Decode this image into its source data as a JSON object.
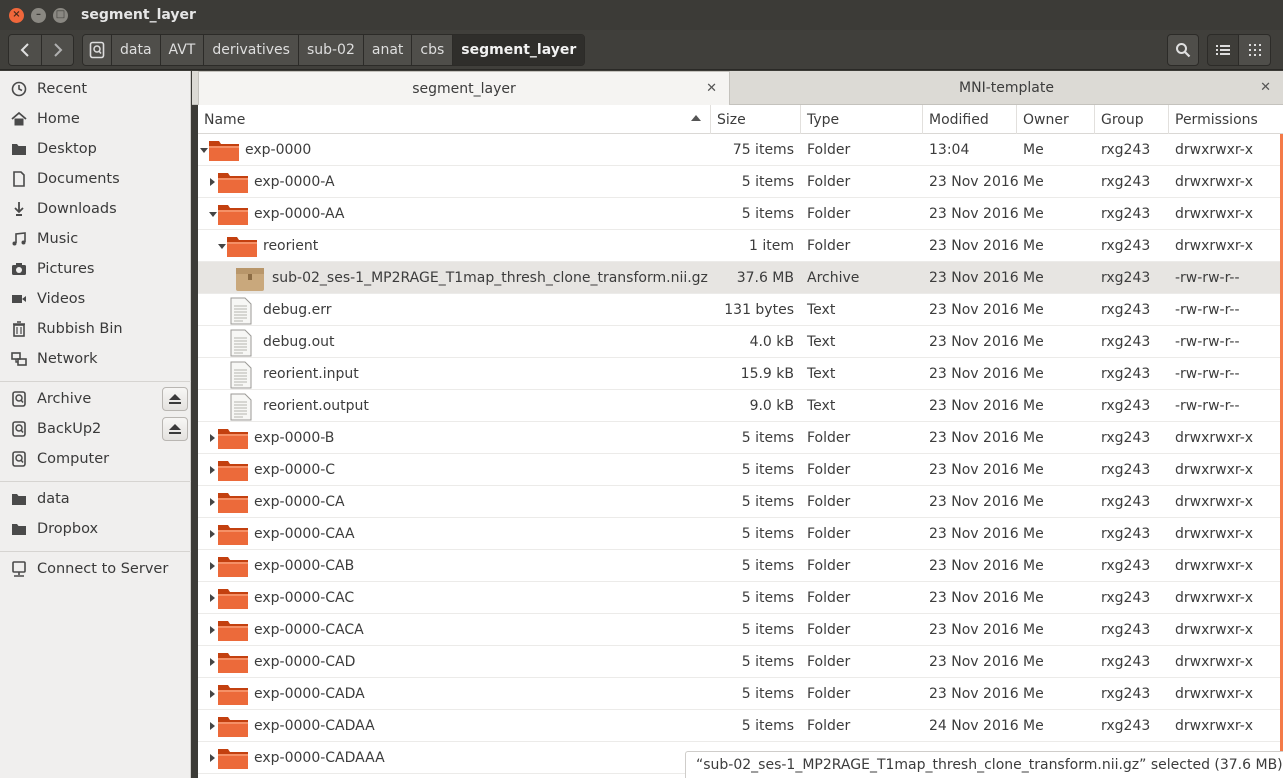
{
  "window": {
    "title": "segment_layer"
  },
  "breadcrumbs": [
    "data",
    "AVT",
    "derivatives",
    "sub-02",
    "anat",
    "cbs",
    "segment_layer"
  ],
  "sidebar": {
    "places": [
      {
        "label": "Recent",
        "icon": "clock-icon"
      },
      {
        "label": "Home",
        "icon": "home-icon"
      },
      {
        "label": "Desktop",
        "icon": "folder-icon"
      },
      {
        "label": "Documents",
        "icon": "document-icon"
      },
      {
        "label": "Downloads",
        "icon": "download-icon"
      },
      {
        "label": "Music",
        "icon": "music-icon"
      },
      {
        "label": "Pictures",
        "icon": "camera-icon"
      },
      {
        "label": "Videos",
        "icon": "video-icon"
      },
      {
        "label": "Rubbish Bin",
        "icon": "trash-icon"
      },
      {
        "label": "Network",
        "icon": "network-icon"
      }
    ],
    "devices": [
      {
        "label": "Archive",
        "icon": "drive-icon",
        "eject": true
      },
      {
        "label": "BackUp2",
        "icon": "drive-icon",
        "eject": true
      },
      {
        "label": "Computer",
        "icon": "drive-icon",
        "eject": false
      }
    ],
    "bookmarks": [
      {
        "label": "data",
        "icon": "folder-icon"
      },
      {
        "label": "Dropbox",
        "icon": "folder-icon"
      }
    ],
    "connect": {
      "label": "Connect to Server",
      "icon": "server-icon"
    }
  },
  "tabs": [
    {
      "label": "segment_layer",
      "active": true
    },
    {
      "label": "MNI-template",
      "active": false
    }
  ],
  "columns": [
    "Name",
    "Size",
    "Type",
    "Modified",
    "Owner",
    "Group",
    "Permissions"
  ],
  "rows": [
    {
      "name": "exp-0000",
      "size": "75 items",
      "type": "Folder",
      "modified": "13:04",
      "owner": "Me",
      "group": "rxg243",
      "perms": "drwxrwxr-x",
      "depth": 0,
      "kind": "folder",
      "exp": "expanded"
    },
    {
      "name": "exp-0000-A",
      "size": "5 items",
      "type": "Folder",
      "modified": "23 Nov 2016",
      "owner": "Me",
      "group": "rxg243",
      "perms": "drwxrwxr-x",
      "depth": 1,
      "kind": "folder",
      "exp": "collapsed"
    },
    {
      "name": "exp-0000-AA",
      "size": "5 items",
      "type": "Folder",
      "modified": "23 Nov 2016",
      "owner": "Me",
      "group": "rxg243",
      "perms": "drwxrwxr-x",
      "depth": 1,
      "kind": "folder",
      "exp": "expanded"
    },
    {
      "name": "reorient",
      "size": "1 item",
      "type": "Folder",
      "modified": "23 Nov 2016",
      "owner": "Me",
      "group": "rxg243",
      "perms": "drwxrwxr-x",
      "depth": 2,
      "kind": "folder",
      "exp": "expanded"
    },
    {
      "name": "sub-02_ses-1_MP2RAGE_T1map_thresh_clone_transform.nii.gz",
      "size": "37.6 MB",
      "type": "Archive",
      "modified": "23 Nov 2016",
      "owner": "Me",
      "group": "rxg243",
      "perms": "-rw-rw-r--",
      "depth": 3,
      "kind": "archive",
      "exp": "none",
      "selected": true
    },
    {
      "name": "debug.err",
      "size": "131 bytes",
      "type": "Text",
      "modified": "23 Nov 2016",
      "owner": "Me",
      "group": "rxg243",
      "perms": "-rw-rw-r--",
      "depth": 2,
      "kind": "text",
      "exp": "none"
    },
    {
      "name": "debug.out",
      "size": "4.0 kB",
      "type": "Text",
      "modified": "23 Nov 2016",
      "owner": "Me",
      "group": "rxg243",
      "perms": "-rw-rw-r--",
      "depth": 2,
      "kind": "text",
      "exp": "none"
    },
    {
      "name": "reorient.input",
      "size": "15.9 kB",
      "type": "Text",
      "modified": "23 Nov 2016",
      "owner": "Me",
      "group": "rxg243",
      "perms": "-rw-rw-r--",
      "depth": 2,
      "kind": "text",
      "exp": "none"
    },
    {
      "name": "reorient.output",
      "size": "9.0 kB",
      "type": "Text",
      "modified": "23 Nov 2016",
      "owner": "Me",
      "group": "rxg243",
      "perms": "-rw-rw-r--",
      "depth": 2,
      "kind": "text",
      "exp": "none"
    },
    {
      "name": "exp-0000-B",
      "size": "5 items",
      "type": "Folder",
      "modified": "23 Nov 2016",
      "owner": "Me",
      "group": "rxg243",
      "perms": "drwxrwxr-x",
      "depth": 1,
      "kind": "folder",
      "exp": "collapsed"
    },
    {
      "name": "exp-0000-C",
      "size": "5 items",
      "type": "Folder",
      "modified": "23 Nov 2016",
      "owner": "Me",
      "group": "rxg243",
      "perms": "drwxrwxr-x",
      "depth": 1,
      "kind": "folder",
      "exp": "collapsed"
    },
    {
      "name": "exp-0000-CA",
      "size": "5 items",
      "type": "Folder",
      "modified": "23 Nov 2016",
      "owner": "Me",
      "group": "rxg243",
      "perms": "drwxrwxr-x",
      "depth": 1,
      "kind": "folder",
      "exp": "collapsed"
    },
    {
      "name": "exp-0000-CAA",
      "size": "5 items",
      "type": "Folder",
      "modified": "23 Nov 2016",
      "owner": "Me",
      "group": "rxg243",
      "perms": "drwxrwxr-x",
      "depth": 1,
      "kind": "folder",
      "exp": "collapsed"
    },
    {
      "name": "exp-0000-CAB",
      "size": "5 items",
      "type": "Folder",
      "modified": "23 Nov 2016",
      "owner": "Me",
      "group": "rxg243",
      "perms": "drwxrwxr-x",
      "depth": 1,
      "kind": "folder",
      "exp": "collapsed"
    },
    {
      "name": "exp-0000-CAC",
      "size": "5 items",
      "type": "Folder",
      "modified": "23 Nov 2016",
      "owner": "Me",
      "group": "rxg243",
      "perms": "drwxrwxr-x",
      "depth": 1,
      "kind": "folder",
      "exp": "collapsed"
    },
    {
      "name": "exp-0000-CACA",
      "size": "5 items",
      "type": "Folder",
      "modified": "23 Nov 2016",
      "owner": "Me",
      "group": "rxg243",
      "perms": "drwxrwxr-x",
      "depth": 1,
      "kind": "folder",
      "exp": "collapsed"
    },
    {
      "name": "exp-0000-CAD",
      "size": "5 items",
      "type": "Folder",
      "modified": "23 Nov 2016",
      "owner": "Me",
      "group": "rxg243",
      "perms": "drwxrwxr-x",
      "depth": 1,
      "kind": "folder",
      "exp": "collapsed"
    },
    {
      "name": "exp-0000-CADA",
      "size": "5 items",
      "type": "Folder",
      "modified": "23 Nov 2016",
      "owner": "Me",
      "group": "rxg243",
      "perms": "drwxrwxr-x",
      "depth": 1,
      "kind": "folder",
      "exp": "collapsed"
    },
    {
      "name": "exp-0000-CADAA",
      "size": "5 items",
      "type": "Folder",
      "modified": "24 Nov 2016",
      "owner": "Me",
      "group": "rxg243",
      "perms": "drwxrwxr-x",
      "depth": 1,
      "kind": "folder",
      "exp": "collapsed"
    },
    {
      "name": "exp-0000-CADAAA",
      "size": "",
      "type": "",
      "modified": "",
      "owner": "",
      "group": "",
      "perms": "",
      "depth": 1,
      "kind": "folder",
      "exp": "collapsed"
    }
  ],
  "status": "“sub-02_ses-1_MP2RAGE_T1map_thresh_clone_transform.nii.gz” selected  (37.6 MB)",
  "colors": {
    "accent": "#f47a48",
    "folder": "#e95420",
    "titlebar": "#3c3b37"
  }
}
